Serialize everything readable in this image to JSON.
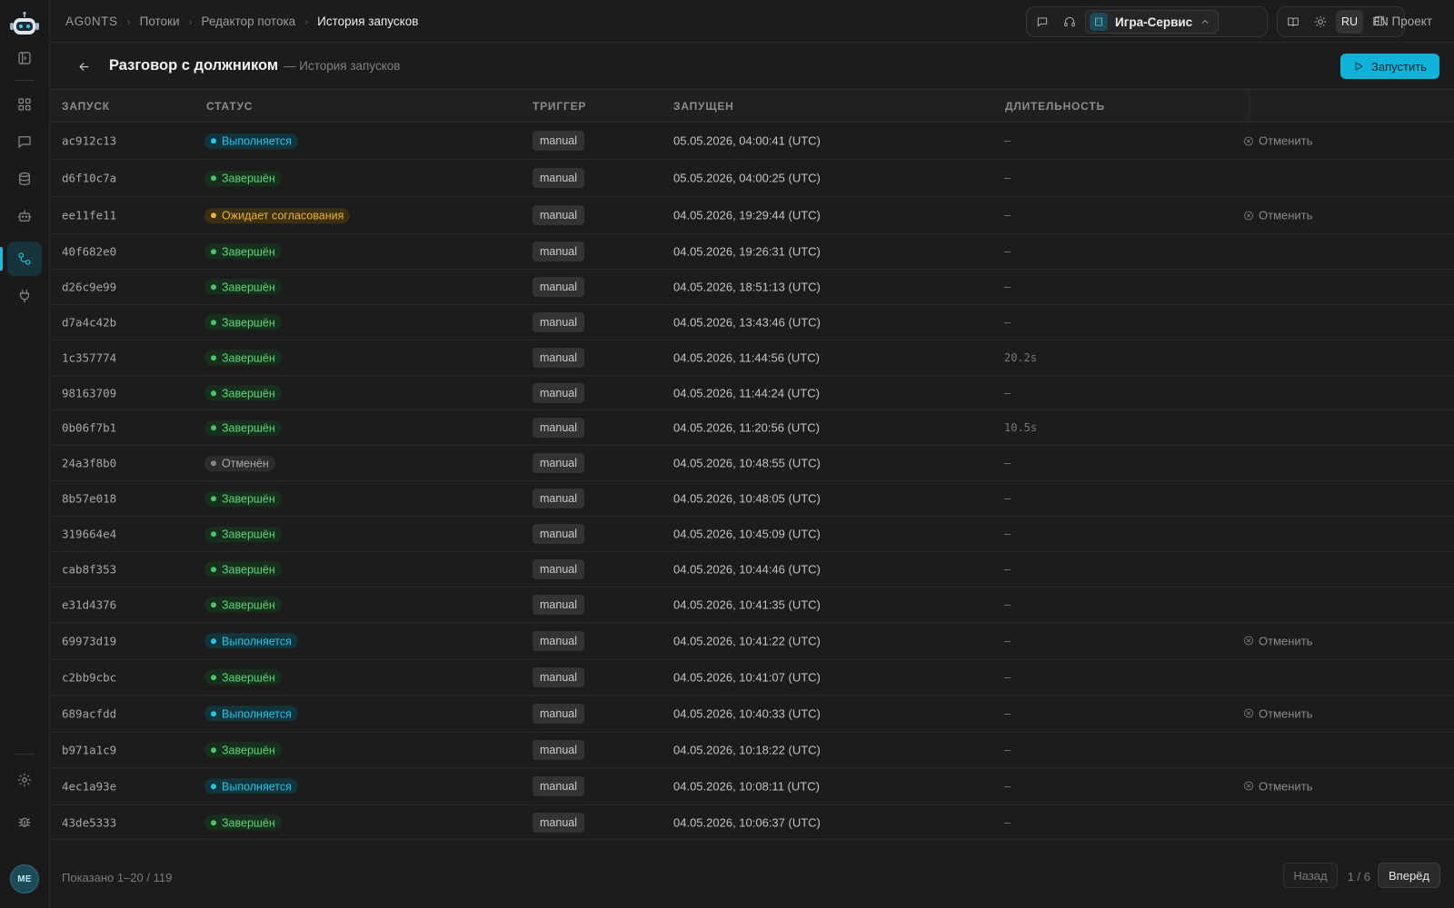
{
  "breadcrumbs": [
    "AG0NTS",
    "Потоки",
    "Редактор потока",
    "История запусков"
  ],
  "workspace": {
    "name": "Игра-Сервис"
  },
  "lang": {
    "ru": "RU",
    "en": "EN",
    "selected": "RU"
  },
  "project_label": "Проект",
  "page": {
    "title": "Разговор с должником",
    "subtitle": "— История запусков",
    "run_button": "Запустить"
  },
  "table": {
    "headers": {
      "run": "ЗАПУСК",
      "status": "СТАТУС",
      "trigger": "ТРИГГЕР",
      "started": "ЗАПУЩЕН",
      "duration": "ДЛИТЕЛЬНОСТЬ"
    },
    "rows": [
      {
        "id": "ac912c13",
        "status": "Выполняется",
        "kind": "run",
        "trigger": "manual",
        "started": "05.05.2026, 04:00:41 (UTC)",
        "duration": "—",
        "action": "Отменить"
      },
      {
        "id": "d6f10c7a",
        "status": "Завершён",
        "kind": "done",
        "trigger": "manual",
        "started": "05.05.2026, 04:00:25 (UTC)",
        "duration": "—",
        "action": ""
      },
      {
        "id": "ee11fe11",
        "status": "Ожидает согласования",
        "kind": "wait",
        "trigger": "manual",
        "started": "04.05.2026, 19:29:44 (UTC)",
        "duration": "—",
        "action": "Отменить"
      },
      {
        "id": "40f682e0",
        "status": "Завершён",
        "kind": "done",
        "trigger": "manual",
        "started": "04.05.2026, 19:26:31 (UTC)",
        "duration": "—",
        "action": ""
      },
      {
        "id": "d26c9e99",
        "status": "Завершён",
        "kind": "done",
        "trigger": "manual",
        "started": "04.05.2026, 18:51:13 (UTC)",
        "duration": "—",
        "action": ""
      },
      {
        "id": "d7a4c42b",
        "status": "Завершён",
        "kind": "done",
        "trigger": "manual",
        "started": "04.05.2026, 13:43:46 (UTC)",
        "duration": "—",
        "action": ""
      },
      {
        "id": "1c357774",
        "status": "Завершён",
        "kind": "done",
        "trigger": "manual",
        "started": "04.05.2026, 11:44:56 (UTC)",
        "duration": "20.2s",
        "action": ""
      },
      {
        "id": "98163709",
        "status": "Завершён",
        "kind": "done",
        "trigger": "manual",
        "started": "04.05.2026, 11:44:24 (UTC)",
        "duration": "—",
        "action": ""
      },
      {
        "id": "0b06f7b1",
        "status": "Завершён",
        "kind": "done",
        "trigger": "manual",
        "started": "04.05.2026, 11:20:56 (UTC)",
        "duration": "10.5s",
        "action": ""
      },
      {
        "id": "24a3f8b0",
        "status": "Отменён",
        "kind": "cancel",
        "trigger": "manual",
        "started": "04.05.2026, 10:48:55 (UTC)",
        "duration": "—",
        "action": ""
      },
      {
        "id": "8b57e018",
        "status": "Завершён",
        "kind": "done",
        "trigger": "manual",
        "started": "04.05.2026, 10:48:05 (UTC)",
        "duration": "—",
        "action": ""
      },
      {
        "id": "319664e4",
        "status": "Завершён",
        "kind": "done",
        "trigger": "manual",
        "started": "04.05.2026, 10:45:09 (UTC)",
        "duration": "—",
        "action": ""
      },
      {
        "id": "cab8f353",
        "status": "Завершён",
        "kind": "done",
        "trigger": "manual",
        "started": "04.05.2026, 10:44:46 (UTC)",
        "duration": "—",
        "action": ""
      },
      {
        "id": "e31d4376",
        "status": "Завершён",
        "kind": "done",
        "trigger": "manual",
        "started": "04.05.2026, 10:41:35 (UTC)",
        "duration": "—",
        "action": ""
      },
      {
        "id": "69973d19",
        "status": "Выполняется",
        "kind": "run",
        "trigger": "manual",
        "started": "04.05.2026, 10:41:22 (UTC)",
        "duration": "—",
        "action": "Отменить"
      },
      {
        "id": "c2bb9cbc",
        "status": "Завершён",
        "kind": "done",
        "trigger": "manual",
        "started": "04.05.2026, 10:41:07 (UTC)",
        "duration": "—",
        "action": ""
      },
      {
        "id": "689acfdd",
        "status": "Выполняется",
        "kind": "run",
        "trigger": "manual",
        "started": "04.05.2026, 10:40:33 (UTC)",
        "duration": "—",
        "action": "Отменить"
      },
      {
        "id": "b971a1c9",
        "status": "Завершён",
        "kind": "done",
        "trigger": "manual",
        "started": "04.05.2026, 10:18:22 (UTC)",
        "duration": "—",
        "action": ""
      },
      {
        "id": "4ec1a93e",
        "status": "Выполняется",
        "kind": "run",
        "trigger": "manual",
        "started": "04.05.2026, 10:08:11 (UTC)",
        "duration": "—",
        "action": "Отменить"
      },
      {
        "id": "43de5333",
        "status": "Завершён",
        "kind": "done",
        "trigger": "manual",
        "started": "04.05.2026, 10:06:37 (UTC)",
        "duration": "—",
        "action": ""
      }
    ]
  },
  "footer": {
    "shown": "Показано 1–20 / 119",
    "prev": "Назад",
    "page_info": "1 / 6",
    "next": "Вперёд"
  },
  "user": {
    "initials": "ME"
  },
  "colors": {
    "accent": "#0fb2d8",
    "running": "#29c4e6",
    "done": "#5ed37a",
    "waiting": "#eab43a",
    "cancelled": "#a8a8a8"
  },
  "icons": [
    "robot-logo-icon",
    "sidebar-toggle-icon",
    "dashboard-icon",
    "chat-icon",
    "database-icon",
    "bot-icon",
    "flows-icon",
    "plug-icon",
    "settings-icon",
    "bug-icon",
    "message-icon",
    "headset-icon",
    "building-icon",
    "chevron-up-icon",
    "book-icon",
    "sun-icon",
    "panel-icon",
    "back-arrow-icon",
    "play-icon",
    "cancel-circle-icon"
  ]
}
